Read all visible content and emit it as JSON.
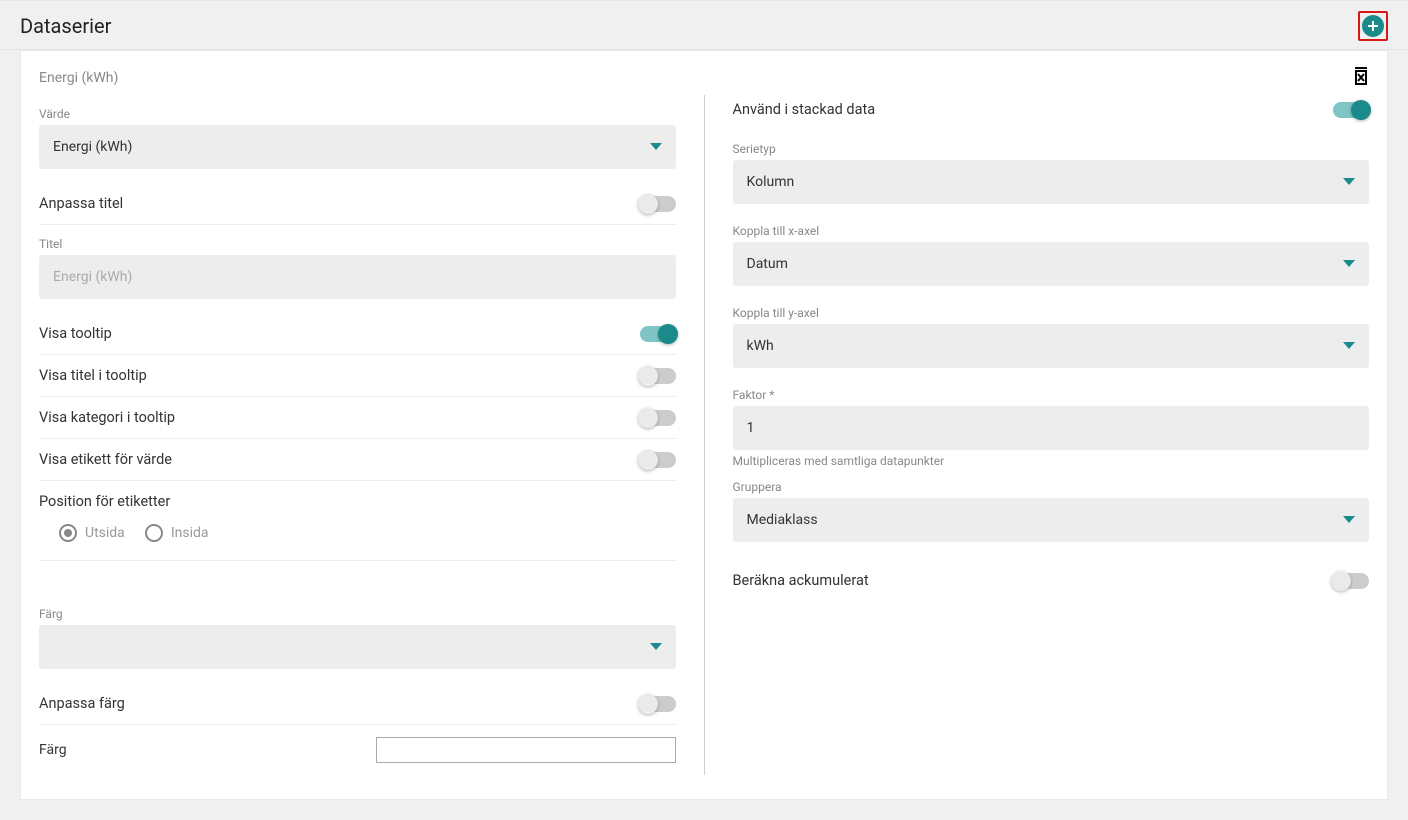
{
  "header": {
    "title": "Dataserier"
  },
  "series": {
    "name": "Energi (kWh)",
    "left": {
      "value_label": "Värde",
      "value_selected": "Energi (kWh)",
      "custom_title_label": "Anpassa titel",
      "title_label": "Titel",
      "title_placeholder": "Energi (kWh)",
      "show_tooltip": "Visa tooltip",
      "show_title_tooltip": "Visa titel i tooltip",
      "show_category_tooltip": "Visa kategori i tooltip",
      "show_value_label": "Visa etikett för värde",
      "label_position": "Position för etiketter",
      "radio_outside": "Utsida",
      "radio_inside": "Insida",
      "color_label": "Färg",
      "color_selected": "",
      "custom_color_label": "Anpassa färg",
      "color_field_label": "Färg"
    },
    "right": {
      "use_stacked": "Använd i stackad data",
      "serietype_label": "Serietyp",
      "serietype_value": "Kolumn",
      "xaxis_label": "Koppla till x-axel",
      "xaxis_value": "Datum",
      "yaxis_label": "Koppla till y-axel",
      "yaxis_value": "kWh",
      "factor_label": "Faktor *",
      "factor_value": "1",
      "factor_hint": "Multipliceras med samtliga datapunkter",
      "group_label": "Gruppera",
      "group_value": "Mediaklass",
      "calc_accum": "Beräkna ackumulerat"
    }
  }
}
